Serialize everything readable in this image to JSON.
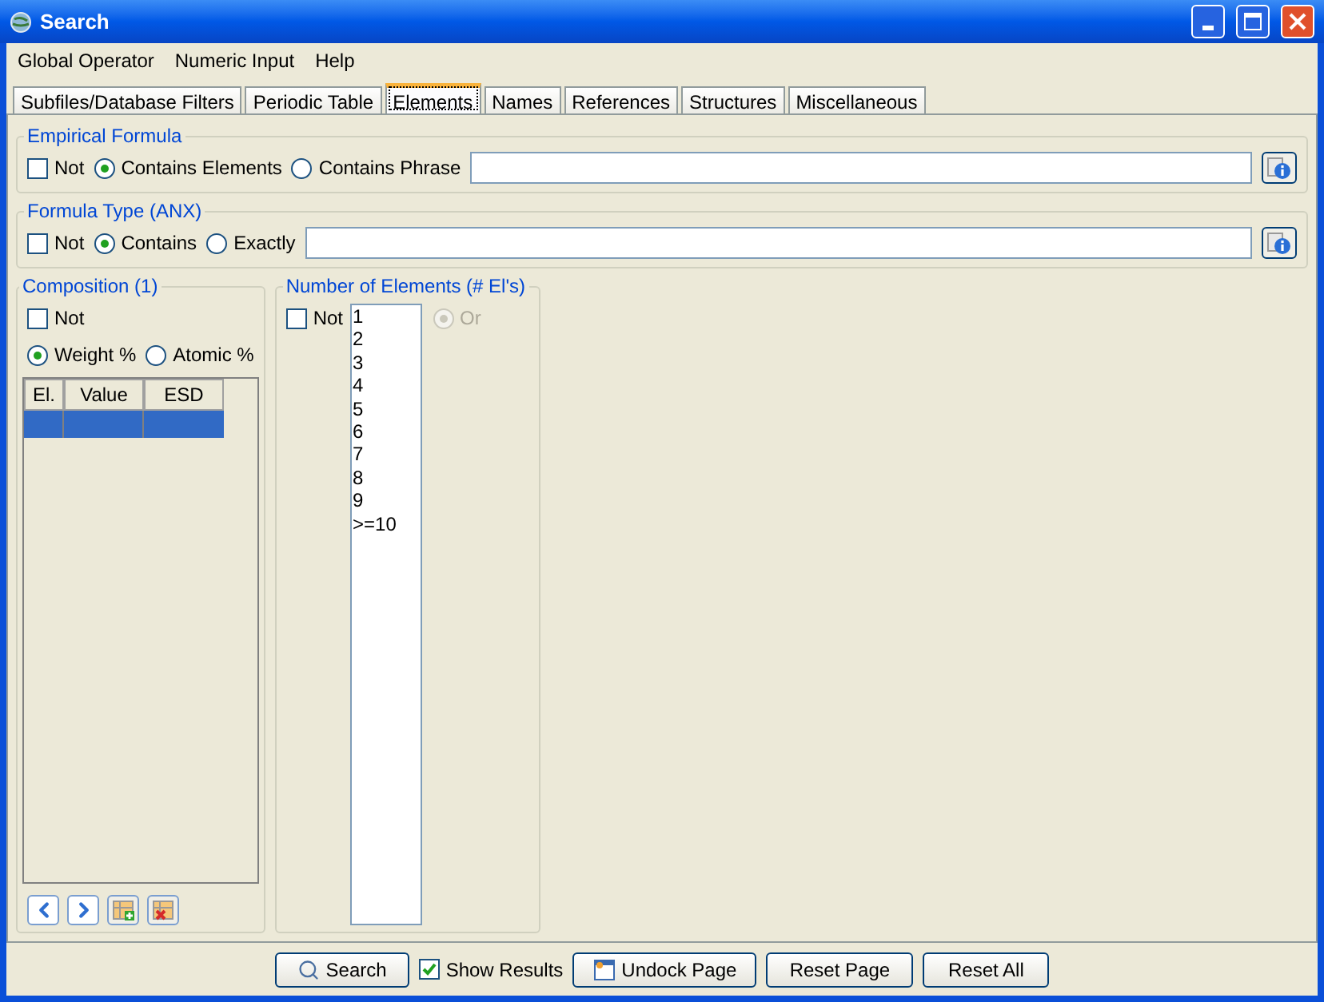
{
  "window": {
    "title": "Search"
  },
  "menu": [
    {
      "label": "Global Operator"
    },
    {
      "label": "Numeric Input"
    },
    {
      "label": "Help"
    }
  ],
  "tabs": [
    {
      "label": "Subfiles/Database Filters",
      "selected": false
    },
    {
      "label": "Periodic Table",
      "selected": false
    },
    {
      "label": "Elements",
      "selected": true
    },
    {
      "label": "Names",
      "selected": false
    },
    {
      "label": "References",
      "selected": false
    },
    {
      "label": "Structures",
      "selected": false
    },
    {
      "label": "Miscellaneous",
      "selected": false
    }
  ],
  "empirical_formula": {
    "title": "Empirical Formula",
    "not": {
      "label": "Not",
      "checked": false
    },
    "options": [
      {
        "label": "Contains Elements",
        "selected": true
      },
      {
        "label": "Contains Phrase",
        "selected": false
      }
    ]
  },
  "formula_type": {
    "title": "Formula Type (ANX)",
    "not": {
      "label": "Not",
      "checked": false
    },
    "options": [
      {
        "label": "Contains",
        "selected": true
      },
      {
        "label": "Exactly",
        "selected": false
      }
    ]
  },
  "composition": {
    "title": "Composition (1)",
    "not": {
      "label": "Not",
      "checked": false
    },
    "options": [
      {
        "label": "Weight %",
        "selected": true
      },
      {
        "label": "Atomic %",
        "selected": false
      }
    ],
    "columns": [
      "El.",
      "Value",
      "ESD"
    ],
    "rows": [
      {
        "selected": true
      }
    ]
  },
  "number_of_elements": {
    "title": "Number of Elements (# El's)",
    "not": {
      "label": "Not",
      "checked": false
    },
    "items": [
      "1",
      "2",
      "3",
      "4",
      "5",
      "6",
      "7",
      "8",
      "9",
      ">=10"
    ],
    "or": {
      "label": "Or",
      "selected": true,
      "disabled": true
    }
  },
  "footer": {
    "search": "Search",
    "show_results": {
      "label": "Show Results",
      "checked": true
    },
    "undock": "Undock Page",
    "reset_page": "Reset Page",
    "reset_all": "Reset All"
  }
}
